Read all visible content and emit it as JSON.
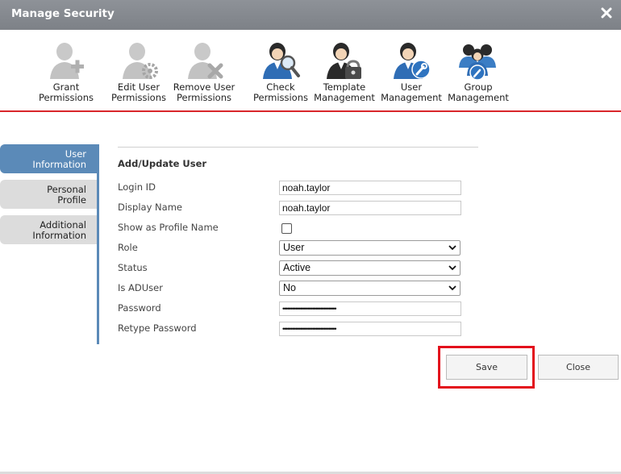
{
  "window": {
    "title": "Manage Security"
  },
  "toolbar": {
    "items": [
      {
        "label": "Grant\nPermissions",
        "icon": "user-plus-icon"
      },
      {
        "label": "Edit User\nPermissions",
        "icon": "user-gear-icon"
      },
      {
        "label": "Remove User\nPermissions",
        "icon": "user-remove-icon"
      },
      {
        "label": "Check\nPermissions",
        "icon": "user-search-icon"
      },
      {
        "label": "Template\nManagement",
        "icon": "user-lock-icon"
      },
      {
        "label": "User\nManagement",
        "icon": "user-wrench-icon"
      },
      {
        "label": "Group\nManagement",
        "icon": "group-wrench-icon"
      }
    ]
  },
  "sidebar": {
    "tabs": [
      {
        "label": "User\nInformation",
        "active": true
      },
      {
        "label": "Personal\nProfile",
        "active": false
      },
      {
        "label": "Additional\nInformation",
        "active": false
      }
    ]
  },
  "form": {
    "section_title": "Add/Update User",
    "login_id": {
      "label": "Login ID",
      "value": "noah.taylor"
    },
    "display_name": {
      "label": "Display Name",
      "value": "noah.taylor"
    },
    "show_as_profile": {
      "label": "Show as Profile Name",
      "checked": false
    },
    "role": {
      "label": "Role",
      "value": "User"
    },
    "status": {
      "label": "Status",
      "value": "Active"
    },
    "is_aduser": {
      "label": "Is ADUser",
      "value": "No"
    },
    "password": {
      "label": "Password",
      "value": "••••••••••••••••••••••••••••••••••"
    },
    "retype_password": {
      "label": "Retype Password",
      "value": "••••••••••••••••••••••••••••••••••"
    }
  },
  "buttons": {
    "save": "Save",
    "close": "Close"
  },
  "colors": {
    "accent_red": "#d9262b",
    "tab_blue": "#5b8ab8",
    "titlebar": "#868a90",
    "highlight": "#e3101c"
  }
}
